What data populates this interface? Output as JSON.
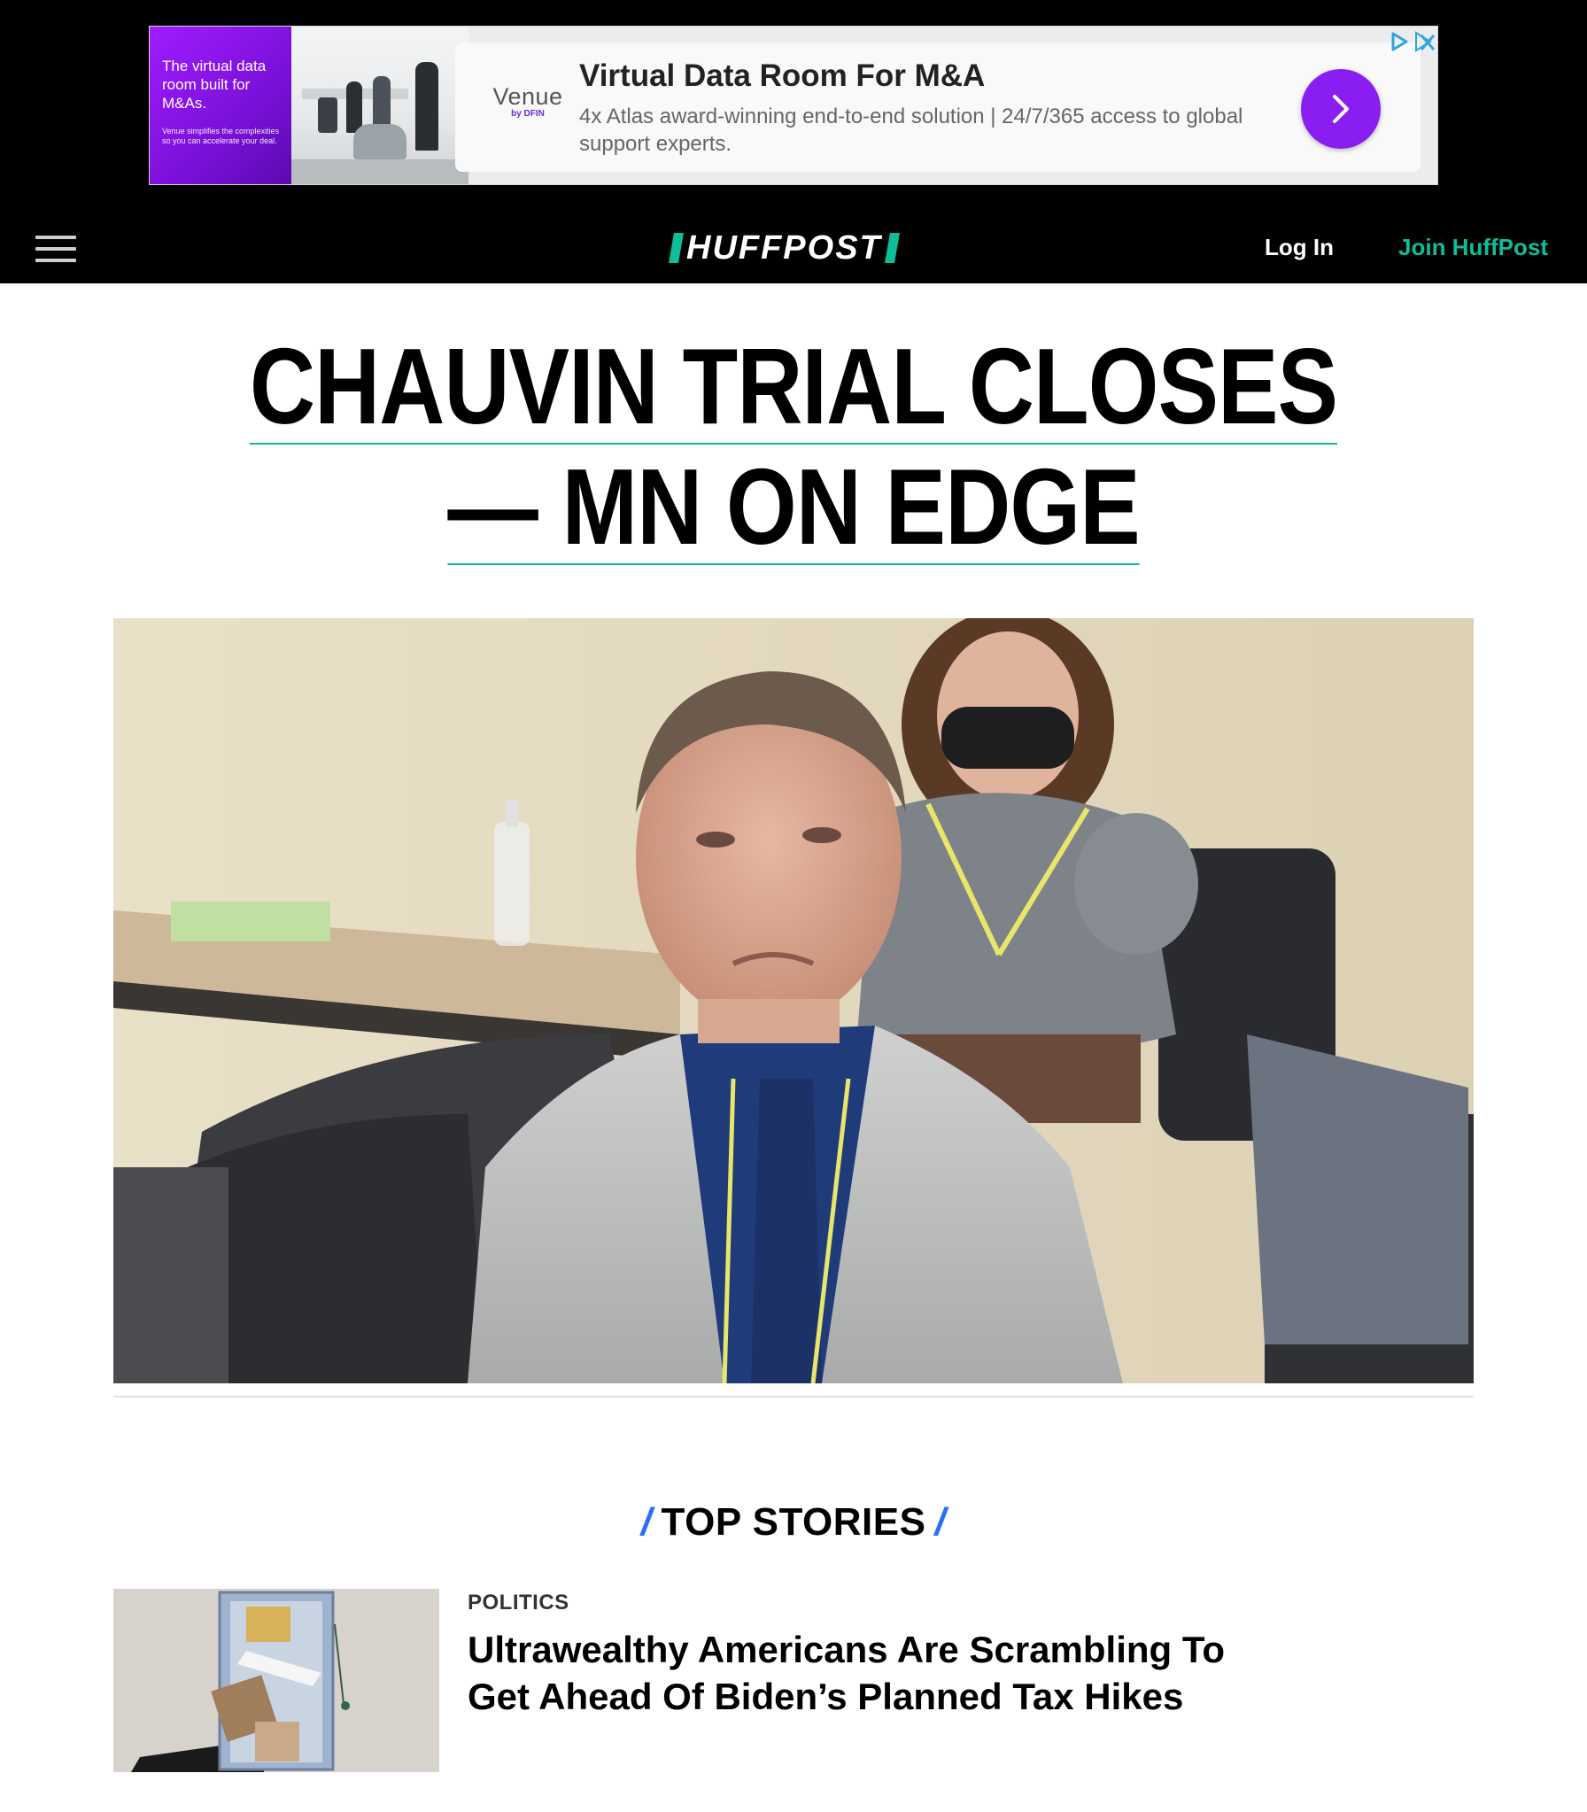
{
  "ad": {
    "promo_line1": "The virtual data room built for M&As.",
    "promo_line2": "Venue simplifies the complexities so you can accelerate your deal.",
    "brand": "Venue",
    "brand_sub": "by DFIN",
    "headline": "Virtual Data Room For M&A",
    "body": "4x Atlas award-winning end-to-end solution | 24/7/365 access to global support experts.",
    "cta_icon": "chevron-right-icon",
    "choices_icons": [
      "adchoices-icon",
      "close-ad-icon"
    ],
    "accent_color": "#8a1ef2"
  },
  "nav": {
    "menu_icon": "hamburger-menu-icon",
    "logo_text": "HUFFPOST",
    "login_label": "Log In",
    "join_label": "Join HuffPost",
    "brand_color": "#0dbe98"
  },
  "headline": {
    "line1": "CHAUVIN TRIAL CLOSES",
    "line2": "— MN ON EDGE"
  },
  "top_stories": {
    "title": "TOP STORIES",
    "slash": "/",
    "slash_color": "#2b6ff2",
    "items": [
      {
        "kicker": "POLITICS",
        "title": "Ultrawealthy Americans Are Scrambling To Get Ahead Of Biden’s Planned Tax Hikes"
      }
    ]
  }
}
